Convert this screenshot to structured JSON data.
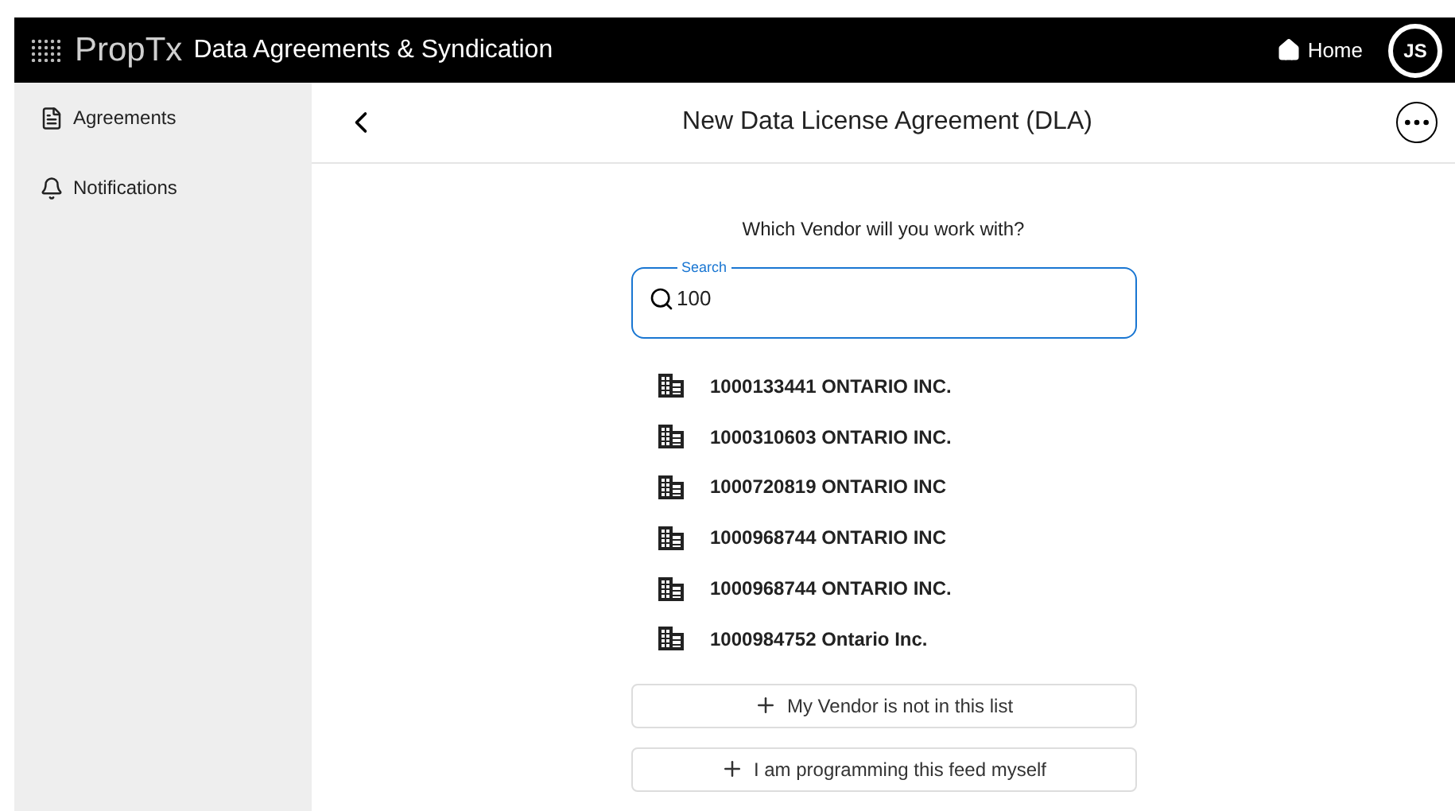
{
  "header": {
    "brand": "PropTx",
    "title": "Data Agreements & Syndication",
    "home_link": "Home",
    "avatar": "JS"
  },
  "sidebar": {
    "items": [
      {
        "label": "Agreements",
        "kind": "document"
      },
      {
        "label": "Notifications",
        "kind": "bell"
      }
    ]
  },
  "page": {
    "title": "New Data License Agreement (DLA)"
  },
  "prompt": "Which Vendor will you work with?",
  "search": {
    "label": "Search",
    "value": "100"
  },
  "vendors": [
    "1000133441 ONTARIO INC.",
    "1000310603 ONTARIO INC.",
    "1000720819 ONTARIO INC",
    "1000968744 ONTARIO INC",
    "1000968744 ONTARIO INC.",
    "1000984752 Ontario Inc."
  ],
  "buttons": [
    "My Vendor is not in this list",
    "I am programming this feed myself"
  ]
}
